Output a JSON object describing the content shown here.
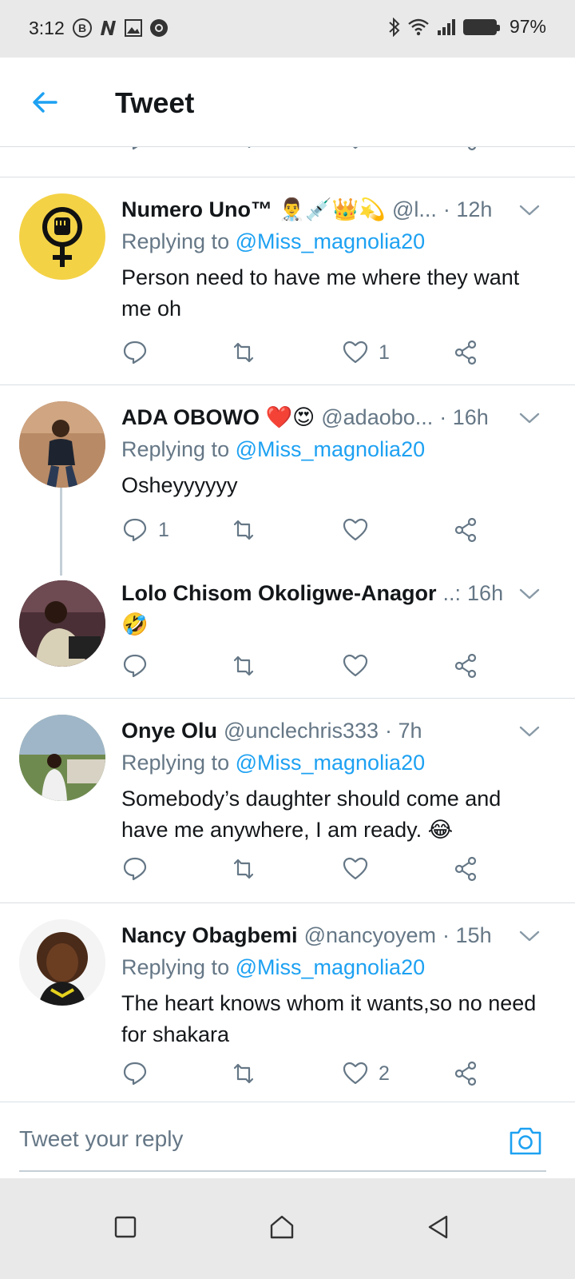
{
  "status_bar": {
    "time": "3:12",
    "battery": "97%",
    "left_icons": [
      "b-circle-icon",
      "n-icon",
      "gallery-icon",
      "chrome-icon"
    ],
    "right_icons": [
      "bluetooth-icon",
      "wifi-icon",
      "signal-icon",
      "battery-icon"
    ]
  },
  "header": {
    "title": "Tweet",
    "back_icon": "back-arrow-icon"
  },
  "colors": {
    "accent": "#1da1f2",
    "text": "#14171a",
    "muted": "#657786",
    "divider": "#d9dfe3",
    "like_red": "#e0245e"
  },
  "tweets": [
    {
      "name": "Numero Uno™ 👨‍⚕️💉👑💫",
      "handle": "@l...",
      "time": "· 12h",
      "replying_prefix": "Replying to ",
      "replying_to": "@Miss_magnolia20",
      "text": "Person need to have me where they want me oh",
      "reply_count": "",
      "retweet_count": "",
      "like_count": "1"
    },
    {
      "name": "ADA OBOWO ❤️😍",
      "handle": "@adaobo...",
      "time": "· 16h",
      "replying_prefix": "Replying to ",
      "replying_to": "@Miss_magnolia20",
      "text": "Osheyyyyyy",
      "reply_count": "1",
      "retweet_count": "",
      "like_count": ""
    },
    {
      "name": "Lolo Chisom Okoligwe-Anagor",
      "handle": "..:",
      "time": "16h",
      "text": "🤣",
      "reply_count": "",
      "retweet_count": "",
      "like_count": ""
    },
    {
      "name": "Onye Olu",
      "handle": "@unclechris333",
      "time": "· 7h",
      "replying_prefix": "Replying to ",
      "replying_to": "@Miss_magnolia20",
      "text": "Somebody’s daughter should come and have me anywhere, I am ready. 😂",
      "reply_count": "",
      "retweet_count": "",
      "like_count": ""
    },
    {
      "name": "Nancy Obagbemi",
      "handle": "@nancyoyem",
      "time": "· 15h",
      "replying_prefix": "Replying to ",
      "replying_to": "@Miss_magnolia20",
      "text": "The heart knows whom it wants,so no need for shakara",
      "reply_count": "",
      "retweet_count": "",
      "like_count": "2"
    }
  ],
  "reply_bar": {
    "placeholder": "Tweet your reply",
    "camera_icon": "camera-icon"
  },
  "nav_bar": {
    "buttons": [
      "recents-square-icon",
      "home-icon",
      "back-triangle-icon"
    ]
  }
}
